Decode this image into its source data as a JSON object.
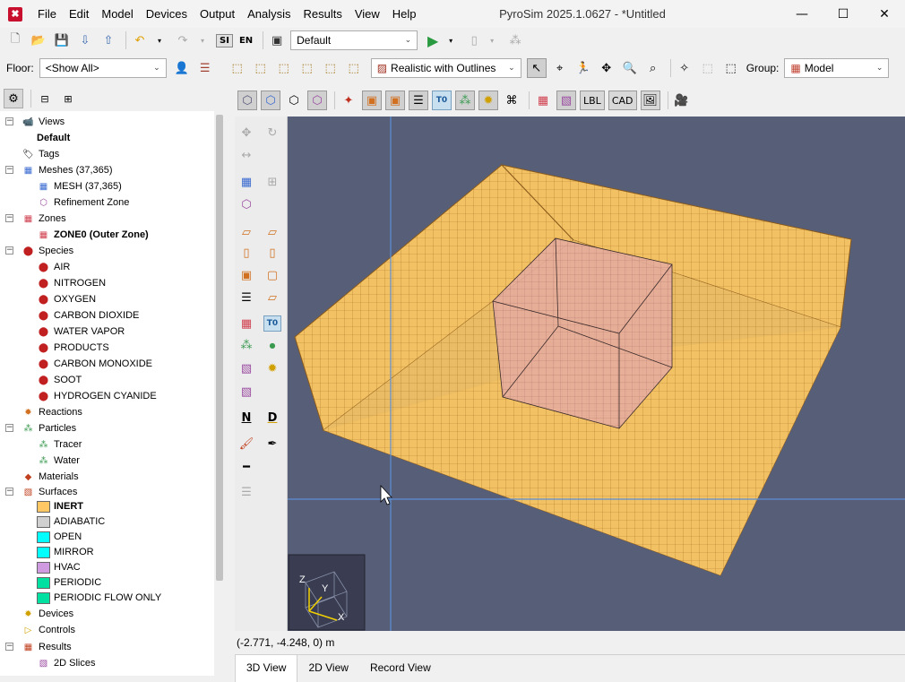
{
  "window": {
    "title": "PyroSim 2025.1.0627 - *Untitled",
    "app_icon": "pyrosim-logo-icon"
  },
  "menu": [
    "File",
    "Edit",
    "Model",
    "Devices",
    "Output",
    "Analysis",
    "Results",
    "View",
    "Help"
  ],
  "toolbar1": {
    "units_si": "SI",
    "units_en": "EN",
    "view_combo": "Default"
  },
  "toolbar2": {
    "floor_label": "Floor:",
    "floor_value": "<Show All>",
    "render_mode": "Realistic with Outlines",
    "group_label": "Group:",
    "group_value": "Model"
  },
  "toolbar3": {
    "lbl": "LBL",
    "cad": "CAD",
    "t0": "T0"
  },
  "tree": {
    "items": [
      {
        "label": "Views",
        "bold": false
      },
      {
        "label": "Default",
        "bold": true
      },
      {
        "label": "Tags",
        "bold": false
      },
      {
        "label": "Meshes (37,365)",
        "bold": false
      },
      {
        "label": "MESH (37,365)",
        "bold": false
      },
      {
        "label": "Refinement Zone",
        "bold": false
      },
      {
        "label": "Zones",
        "bold": false
      },
      {
        "label": "ZONE0 (Outer Zone)",
        "bold": true
      },
      {
        "label": "Species",
        "bold": false
      },
      {
        "label": "AIR",
        "bold": false
      },
      {
        "label": "NITROGEN",
        "bold": false
      },
      {
        "label": "OXYGEN",
        "bold": false
      },
      {
        "label": "CARBON DIOXIDE",
        "bold": false
      },
      {
        "label": "WATER VAPOR",
        "bold": false
      },
      {
        "label": "PRODUCTS",
        "bold": false
      },
      {
        "label": "CARBON MONOXIDE",
        "bold": false
      },
      {
        "label": "SOOT",
        "bold": false
      },
      {
        "label": "HYDROGEN CYANIDE",
        "bold": false
      },
      {
        "label": "Reactions",
        "bold": false
      },
      {
        "label": "Particles",
        "bold": false
      },
      {
        "label": "Tracer",
        "bold": false
      },
      {
        "label": "Water",
        "bold": false
      },
      {
        "label": "Materials",
        "bold": false
      },
      {
        "label": "Surfaces",
        "bold": false
      },
      {
        "label": "INERT",
        "bold": true
      },
      {
        "label": "ADIABATIC",
        "bold": false
      },
      {
        "label": "OPEN",
        "bold": false
      },
      {
        "label": "MIRROR",
        "bold": false
      },
      {
        "label": "HVAC",
        "bold": false
      },
      {
        "label": "PERIODIC",
        "bold": false
      },
      {
        "label": "PERIODIC FLOW ONLY",
        "bold": false
      },
      {
        "label": "Devices",
        "bold": false
      },
      {
        "label": "Controls",
        "bold": false
      },
      {
        "label": "Results",
        "bold": false
      },
      {
        "label": "2D Slices",
        "bold": false
      }
    ],
    "surface_colors": {
      "INERT": "#ffc864",
      "ADIABATIC": "#d0d0d0",
      "OPEN": "#00ffff",
      "MIRROR": "#00ffff",
      "HVAC": "#d09ae0",
      "PERIODIC": "#00e0a0",
      "PERIODIC FLOW ONLY": "#00e0a0"
    }
  },
  "axes": {
    "z": "Z",
    "y": "Y",
    "x": "X"
  },
  "status": {
    "coords": "(-2.771, -4.248, 0) m"
  },
  "tabs": [
    "3D View",
    "2D View",
    "Record View"
  ],
  "colors": {
    "viewport_bg": "#575e78",
    "mesh_fill": "#f2c164",
    "mesh_line": "#b07a2a",
    "zone_fill": "#e5aca0",
    "cursor_line": "#5b8fd6"
  }
}
